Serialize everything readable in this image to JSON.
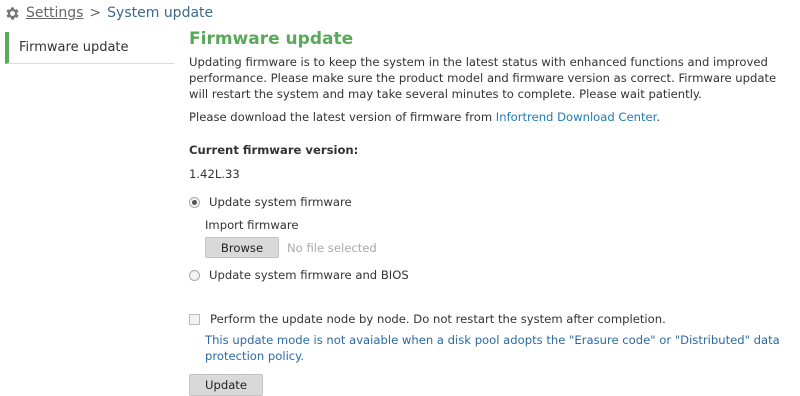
{
  "breadcrumb": {
    "icon": "gear-icon",
    "settings_label": "Settings",
    "separator": ">",
    "current_label": "System update"
  },
  "sidebar": {
    "items": [
      {
        "label": "Firmware update",
        "active": true
      }
    ]
  },
  "main": {
    "title": "Firmware update",
    "intro": "Updating firmware is to keep the system in the latest status with enhanced functions and improved performance. Please make sure the product model and firmware version as correct. Firmware update will restart the system and may take several minutes to complete. Please wait patiently.",
    "download_prefix": "Please download the latest version of firmware from ",
    "download_link": "Infortrend Download Center",
    "download_suffix": ".",
    "current_version_label": "Current firmware version:",
    "current_version": "1.42L.33",
    "options": [
      {
        "label": "Update system firmware",
        "checked": true
      },
      {
        "label": "Update system firmware and BIOS",
        "checked": false
      }
    ],
    "import_label": "Import firmware",
    "browse_label": "Browse",
    "no_file_text": "No file selected",
    "node_by_node_label": "Perform the update node by node. Do not restart the system after completion.",
    "node_by_node_note": "This update mode is not avaiable when a disk pool adopts the \"Erasure code\" or \"Distributed\" data protection policy.",
    "update_label": "Update"
  },
  "colors": {
    "accent_green": "#5aa85a",
    "link_blue": "#1f7bb6",
    "note_blue": "#2c6aa0"
  }
}
